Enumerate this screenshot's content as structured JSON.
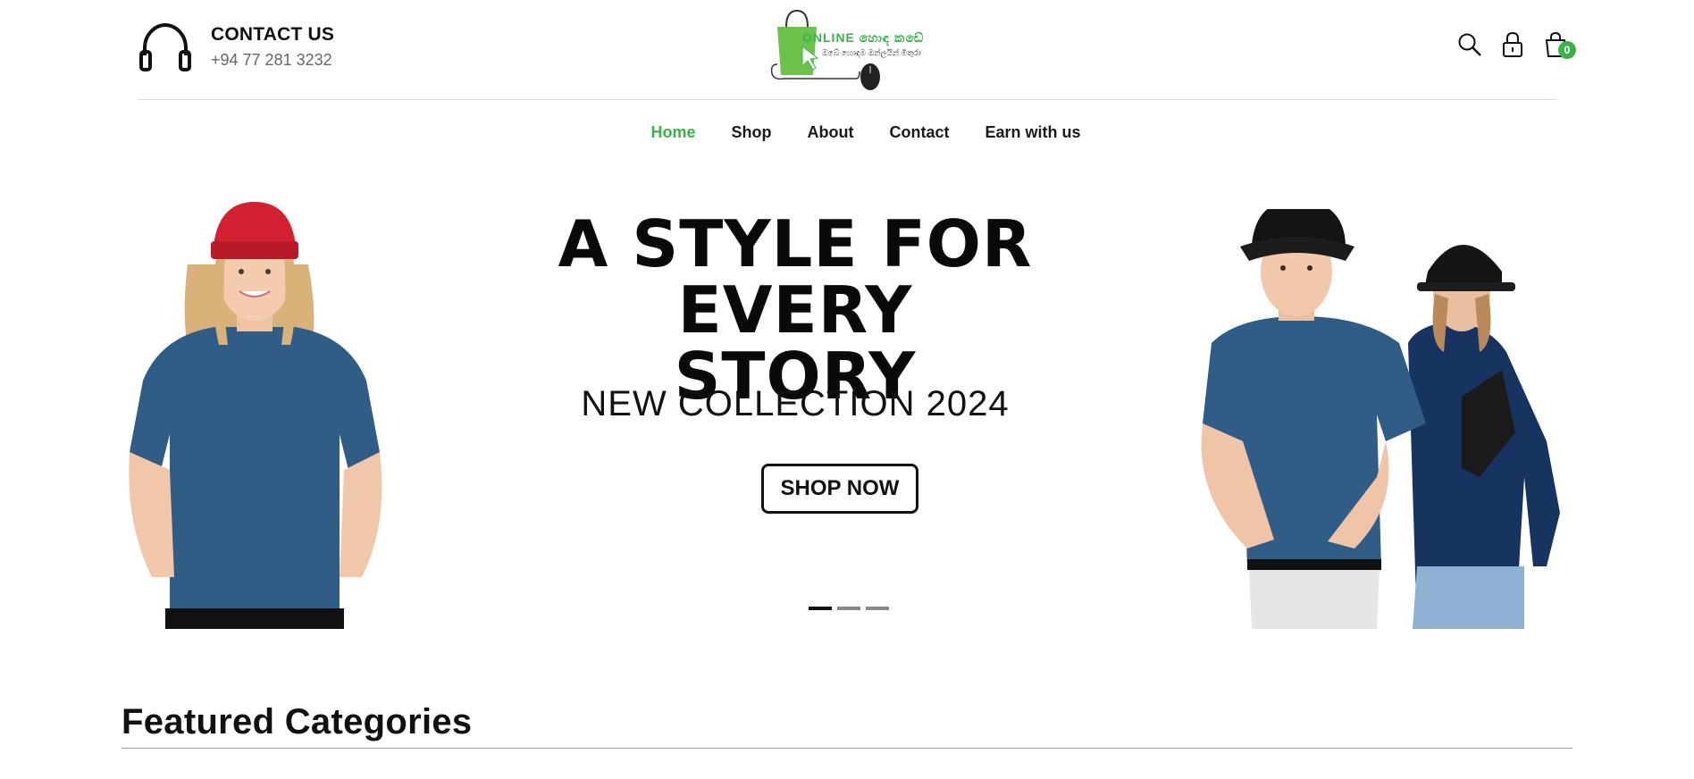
{
  "contact": {
    "icon": "headphones-icon",
    "title": "CONTACT US",
    "phone": "+94 77 281 3232"
  },
  "logo": {
    "brand_text": "ONLINE හොඳ කඩේ",
    "sub_text": "ඔබේ හොඳම ඔන්ලයින් මිතුරා",
    "colors": {
      "bag": "#6cc24a",
      "accent": "#3bb34a",
      "mouse": "#222222"
    }
  },
  "header_icons": {
    "search": "search-icon",
    "account": "lock-icon",
    "cart": "cart-icon",
    "cart_count": "0"
  },
  "nav": {
    "items": [
      {
        "label": "Home",
        "active": true
      },
      {
        "label": "Shop",
        "active": false
      },
      {
        "label": "About",
        "active": false
      },
      {
        "label": "Contact",
        "active": false
      },
      {
        "label": "Earn with us",
        "active": false
      }
    ]
  },
  "hero": {
    "headline_line1": "A STYLE FOR EVERY",
    "headline_line2": "STORY",
    "subheadline": "NEW COLLECTION 2024",
    "cta_label": "SHOP NOW",
    "slides": 3,
    "active_slide": 1
  },
  "featured": {
    "title": "Featured Categories"
  },
  "theme": {
    "accent": "#3bb34a",
    "text": "#111111",
    "shirt_blue": "#2f5d86",
    "beanie_red": "#d2202f"
  }
}
